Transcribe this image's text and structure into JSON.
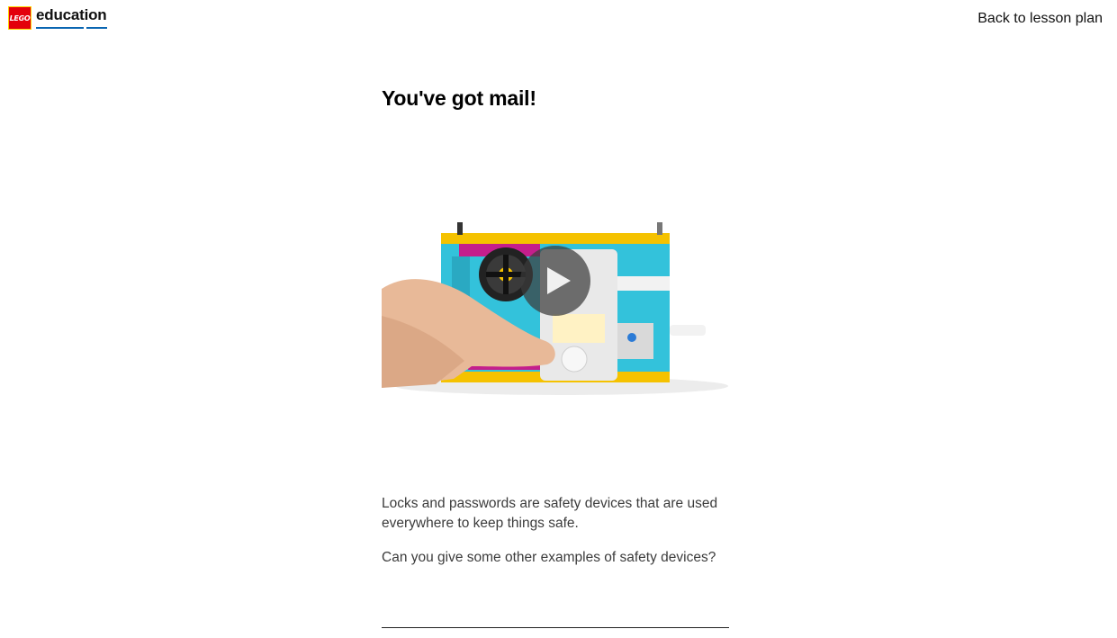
{
  "header": {
    "logo_badge": "LEGO",
    "logo_word": "education",
    "back_link": "Back to lesson plan"
  },
  "main": {
    "title": "You've got mail!",
    "video": {
      "thumbnail": "finger-pressing-button-on-lego-box-model",
      "play_icon": "play-icon"
    },
    "paragraphs": [
      "Locks and passwords are safety devices that are used everywhere to keep things safe.",
      "Can you give some other examples of safety devices?"
    ],
    "answer_value": ""
  },
  "colors": {
    "lego_red": "#e3000b",
    "edu_blue": "#0a66b2",
    "model_azure": "#33c2db",
    "model_yellow": "#f5c200",
    "model_magenta": "#c41e8c"
  }
}
